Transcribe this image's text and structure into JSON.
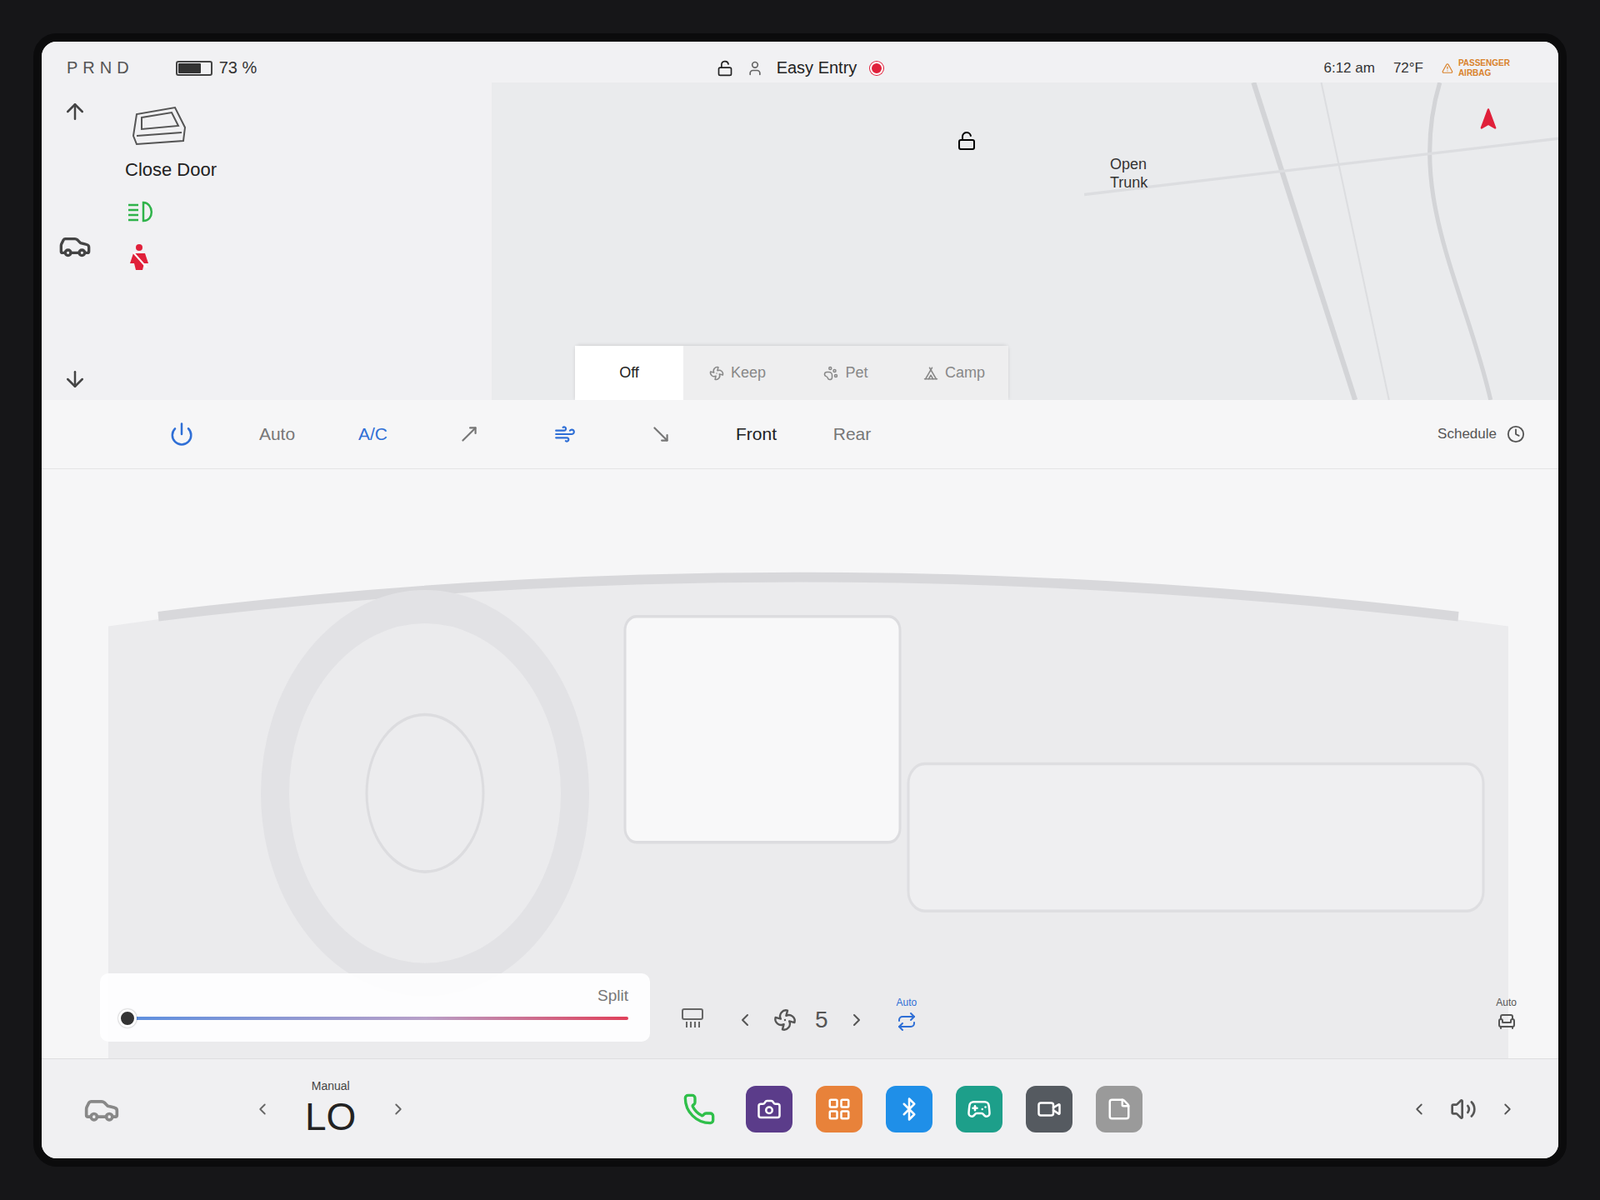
{
  "gear": {
    "text": "PRND"
  },
  "battery": {
    "level": 0.73,
    "reading": "73 %"
  },
  "status": {
    "locked": false,
    "profile": "Easy Entry",
    "recording": true,
    "time": "6:12 am",
    "temperature": "72°F",
    "airbag": "PASSENGER AIRBAG"
  },
  "vehicle": {
    "door": "Close Door",
    "headlights_on": true,
    "seatbelt_warning": true
  },
  "map": {
    "trunk": "Open Trunk",
    "trunk_locked": false
  },
  "keep_modes": [
    {
      "label": "Off",
      "kind": "off",
      "selected": true
    },
    {
      "label": "Keep",
      "kind": "keep",
      "selected": false
    },
    {
      "label": "Pet",
      "kind": "pet",
      "selected": false
    },
    {
      "label": "Camp",
      "kind": "camp",
      "selected": false
    }
  ],
  "climate": {
    "power": true,
    "modes": [
      {
        "label": "Auto",
        "selected": false
      },
      {
        "label": "A/C",
        "selected": true
      }
    ],
    "airflow": [
      {
        "kind": "face",
        "selected": false
      },
      {
        "kind": "both",
        "selected": true
      },
      {
        "kind": "feet",
        "selected": false
      }
    ],
    "zones": [
      {
        "label": "Front",
        "selected": true
      },
      {
        "label": "Rear",
        "selected": false
      }
    ],
    "schedule": "Schedule"
  },
  "controls": {
    "split": "Split",
    "temp_level": 0.0,
    "fan": "5",
    "recirc": "Auto",
    "seat": "Auto"
  },
  "taskbar": {
    "mode": "Manual",
    "temperature": "LO",
    "apps": [
      {
        "kind": "phone",
        "color": "#2fbf4a"
      },
      {
        "kind": "camera",
        "color": "#5b3c8a"
      },
      {
        "kind": "apps",
        "color": "#e8823a"
      },
      {
        "kind": "bluetooth",
        "color": "#1f8fe8"
      },
      {
        "kind": "toybox",
        "color": "#1d9f8a"
      },
      {
        "kind": "dashcam",
        "color": "#555a60"
      },
      {
        "kind": "notes",
        "color": "#9a9a9a"
      }
    ]
  }
}
